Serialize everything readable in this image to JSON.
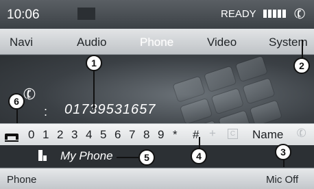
{
  "status_bar": {
    "time": "10:06",
    "ready_label": "READY",
    "signal_bars": 5,
    "phone_status_icon": "handset-icon"
  },
  "menu_bar": {
    "items": [
      {
        "label": "Navi",
        "active": false
      },
      {
        "label": "Audio",
        "active": false
      },
      {
        "label": "Phone",
        "active": true
      },
      {
        "label": "Video",
        "active": false
      },
      {
        "label": "System",
        "active": false
      }
    ]
  },
  "call_display": {
    "call_icon": "handset-icon",
    "separator": ":",
    "number": "01739531657"
  },
  "digit_row": {
    "hangup_icon": "end-call-icon",
    "digits": [
      "0",
      "1",
      "2",
      "3",
      "4",
      "5",
      "6",
      "7",
      "8",
      "9",
      "*",
      "#"
    ],
    "plus": "+",
    "clear_symbol": "C",
    "name_label": "Name",
    "name_icon": "handset-icon"
  },
  "device_row": {
    "device_icon": "mobile-device-icon",
    "device_name": "My Phone"
  },
  "bottom_bar": {
    "left_label": "Phone",
    "right_label": "Mic Off"
  },
  "callouts": [
    "1",
    "2",
    "3",
    "4",
    "5",
    "6"
  ],
  "colors": {
    "menu_active": "#ffffff",
    "screen_background": "#3a3f44",
    "digit_bar": "#e8eaec"
  }
}
